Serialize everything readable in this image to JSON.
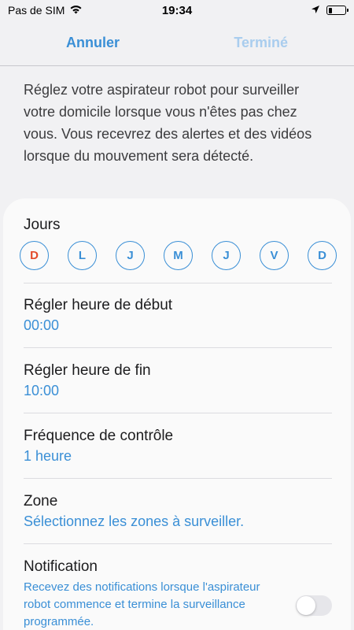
{
  "status_bar": {
    "carrier": "Pas de SIM",
    "time": "19:34"
  },
  "nav": {
    "cancel_label": "Annuler",
    "done_label": "Terminé"
  },
  "intro_text": "Réglez votre aspirateur robot pour surveiller votre domicile lorsque vous n'êtes pas chez vous. Vous recevrez des alertes et des vidéos lorsque du mouvement sera détecté.",
  "days_section": {
    "title": "Jours",
    "days": [
      "D",
      "L",
      "J",
      "M",
      "J",
      "V",
      "D"
    ]
  },
  "start_time": {
    "title": "Régler heure de début",
    "value": "00:00"
  },
  "end_time": {
    "title": "Régler heure de fin",
    "value": "10:00"
  },
  "frequency": {
    "title": "Fréquence de contrôle",
    "value": "1 heure"
  },
  "zone": {
    "title": "Zone",
    "value": "Sélectionnez les zones à surveiller."
  },
  "notification": {
    "title": "Notification",
    "description": "Recevez des notifications lorsque l'aspirateur robot commence et termine la surveillance programmée.",
    "enabled": false
  },
  "colors": {
    "accent": "#3a8fd6",
    "accent_disabled": "#a9cdee",
    "sunday": "#e34b2b",
    "background": "#f1f1f3",
    "card": "#fafafa"
  },
  "icons": [
    "wifi-icon",
    "location-arrow-icon",
    "battery-icon"
  ]
}
